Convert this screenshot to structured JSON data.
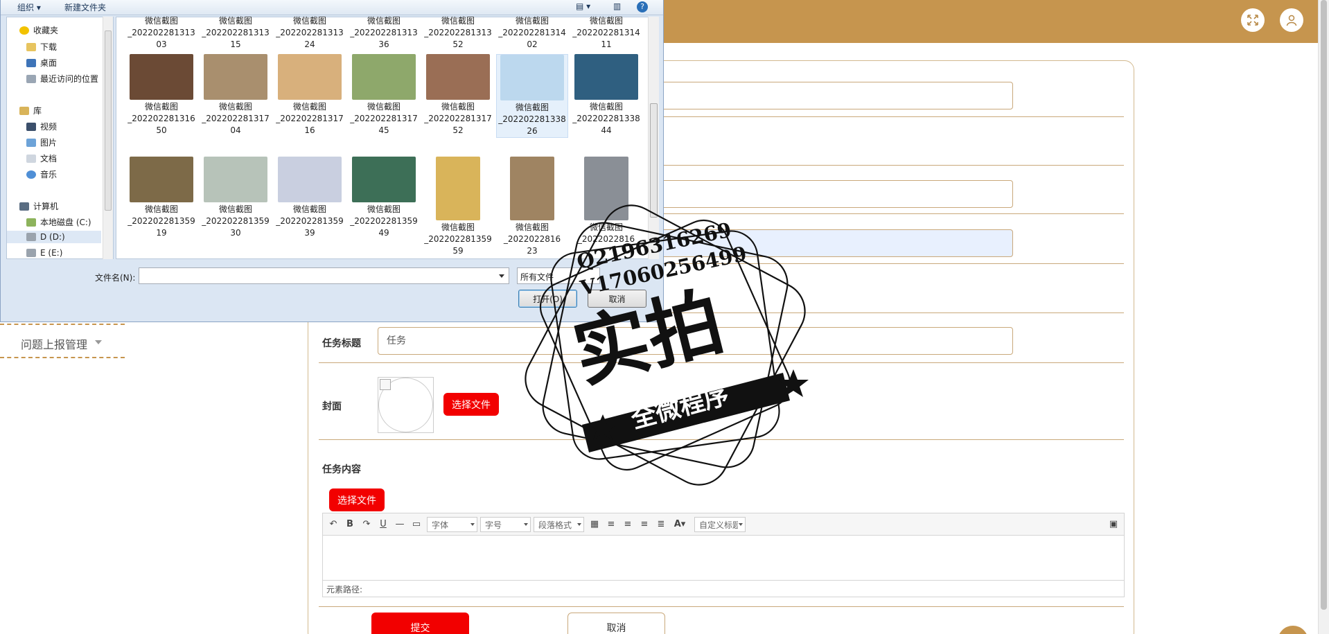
{
  "header": {
    "expand_icon": "expand-arrows-icon",
    "user_icon": "user-icon"
  },
  "side_menu": {
    "item_label": "问题上报管理"
  },
  "form": {
    "title_label": "任务标题",
    "title_value": "任务",
    "cover_label": "封面",
    "cover_button": "选择文件",
    "content_label": "任务内容",
    "content_button": "选择文件",
    "editor": {
      "font_select": "字体",
      "size_select": "字号",
      "paragraph_select": "段落格式",
      "custom_select": "自定义标题",
      "footer_path": "元素路径:"
    },
    "submit_label": "提交",
    "cancel_label": "取消"
  },
  "dialog": {
    "toolbar": {
      "organize": "组织 ▾",
      "new_folder": "新建文件夹",
      "help": "?"
    },
    "nav": {
      "favorites": "收藏夹",
      "downloads": "下载",
      "desktop": "桌面",
      "recent": "最近访问的位置",
      "libraries": "库",
      "videos": "视频",
      "pictures": "图片",
      "documents": "文档",
      "music": "音乐",
      "computer": "计算机",
      "drive_c": "本地磁盘 (C:)",
      "drive_d": "D (D:)",
      "drive_e": "E (E:)"
    },
    "files_row1": [
      {
        "l1": "微信截图",
        "l2": "_202202281313",
        "l3": "03"
      },
      {
        "l1": "微信截图",
        "l2": "_202202281313",
        "l3": "15"
      },
      {
        "l1": "微信截图",
        "l2": "_202202281313",
        "l3": "24"
      },
      {
        "l1": "微信截图",
        "l2": "_202202281313",
        "l3": "36"
      },
      {
        "l1": "微信截图",
        "l2": "_202202281313",
        "l3": "52"
      },
      {
        "l1": "微信截图",
        "l2": "_202202281314",
        "l3": "02"
      },
      {
        "l1": "微信截图",
        "l2": "_202202281314",
        "l3": "11"
      }
    ],
    "files_row2": [
      {
        "l1": "微信截图",
        "l2": "_202202281316",
        "l3": "50",
        "color": "#6b4a35"
      },
      {
        "l1": "微信截图",
        "l2": "_202202281317",
        "l3": "04",
        "color": "#a98f6e"
      },
      {
        "l1": "微信截图",
        "l2": "_202202281317",
        "l3": "16",
        "color": "#d8b07c"
      },
      {
        "l1": "微信截图",
        "l2": "_202202281317",
        "l3": "45",
        "color": "#8ea86b"
      },
      {
        "l1": "微信截图",
        "l2": "_202202281317",
        "l3": "52",
        "color": "#9a6e55"
      },
      {
        "l1": "微信截图",
        "l2": "_202202281338",
        "l3": "26",
        "color": "#bcd8ee"
      },
      {
        "l1": "微信截图",
        "l2": "_202202281338",
        "l3": "44",
        "color": "#2f5f80"
      }
    ],
    "files_row3": [
      {
        "l1": "微信截图",
        "l2": "_202202281359",
        "l3": "19",
        "color": "#7d6a48"
      },
      {
        "l1": "微信截图",
        "l2": "_202202281359",
        "l3": "30",
        "color": "#b7c3b9"
      },
      {
        "l1": "微信截图",
        "l2": "_202202281359",
        "l3": "39",
        "color": "#c9cfe0"
      },
      {
        "l1": "微信截图",
        "l2": "_202202281359",
        "l3": "49",
        "color": "#3d6f57"
      },
      {
        "l1": "微信截图",
        "l2": "_202202281359",
        "l3": "59",
        "color": "#d9b45a"
      },
      {
        "l1": "微信截图",
        "l2": "_2022022816",
        "l3": "23",
        "color": "#9f8462"
      },
      {
        "l1": "微信截图",
        "l2": "_2022022816",
        "l3": "",
        "color": "#8a8f96"
      }
    ],
    "filename_label": "文件名(N):",
    "filetype_value": "所有文件",
    "open_button": "打开(O)",
    "cancel_button": "取消"
  },
  "watermark": {
    "line_q": "Q2196316269",
    "line_v": "V17060256499",
    "big_text": "实拍",
    "banner_text": "全微程序"
  },
  "colors": {
    "header": "#c6954e",
    "accent_red": "#f20000",
    "border_gold": "#c9a87a"
  }
}
